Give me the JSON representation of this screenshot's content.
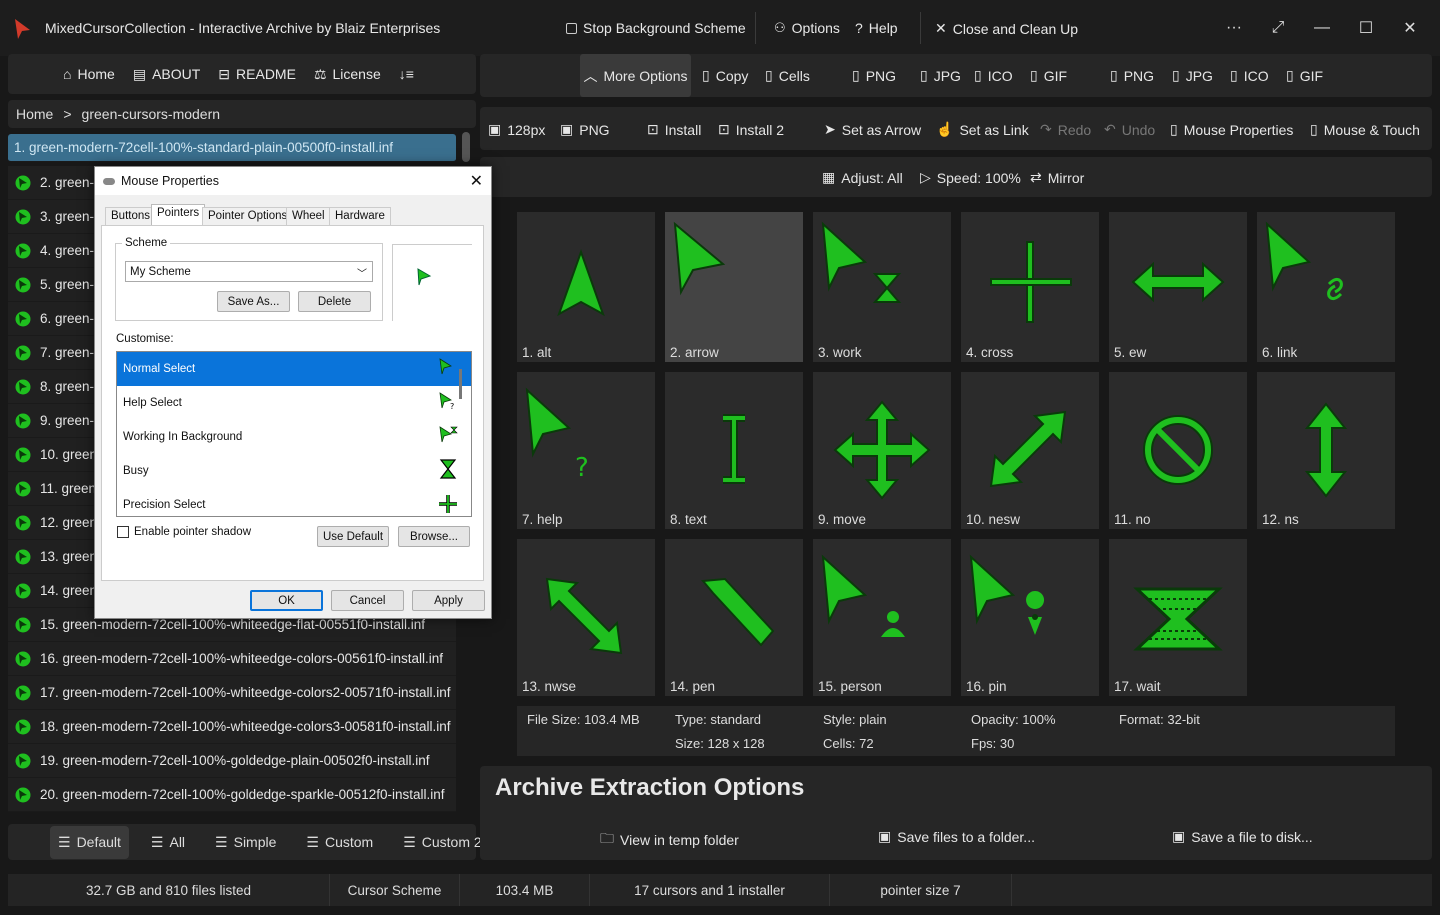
{
  "titlebar": {
    "app_title": "MixedCursorCollection  -  Interactive Archive by Blaiz Enterprises",
    "stop_bg": "Stop Background Scheme",
    "options": "Options",
    "help": "Help",
    "close_clean": "Close and Clean Up",
    "more": "···"
  },
  "leftnav": {
    "home": "Home",
    "about": "ABOUT",
    "readme": "README",
    "license": "License",
    "sort": "↓≡"
  },
  "breadcrumb": {
    "home": "Home",
    "sep": ">",
    "current": "green-cursors-modern"
  },
  "files": [
    "1. green-modern-72cell-100%-standard-plain-00500f0-install.inf",
    "2. green-m",
    "3. green-m",
    "4. green-m",
    "5. green-m",
    "6. green-m",
    "7. green-m",
    "8. green-m",
    "9. green-m",
    "10. green-",
    "11. green-",
    "12. green-",
    "13. green-",
    "14. green-",
    "15. green-modern-72cell-100%-whiteedge-flat-00551f0-install.inf",
    "16. green-modern-72cell-100%-whiteedge-colors-00561f0-install.inf",
    "17. green-modern-72cell-100%-whiteedge-colors2-00571f0-install.inf",
    "18. green-modern-72cell-100%-whiteedge-colors3-00581f0-install.inf",
    "19. green-modern-72cell-100%-goldedge-plain-00502f0-install.inf",
    "20. green-modern-72cell-100%-goldedge-sparkle-00512f0-install.inf"
  ],
  "bottom_tabs": [
    "Default",
    "All",
    "Simple",
    "Custom",
    "Custom 2"
  ],
  "toolbar1": {
    "more_options": "More Options",
    "copy": "Copy",
    "cells": "Cells",
    "png": "PNG",
    "jpg": "JPG",
    "ico": "ICO",
    "gif": "GIF"
  },
  "toolbar2": {
    "size": "128px",
    "png": "PNG",
    "install": "Install",
    "install2": "Install 2",
    "set_arrow": "Set as Arrow",
    "set_link": "Set as Link",
    "redo": "Redo",
    "undo": "Undo",
    "mouse_props": "Mouse Properties",
    "mouse_touch": "Mouse & Touch"
  },
  "toolbar3": {
    "adjust": "Adjust: All",
    "speed": "Speed: 100%",
    "mirror": "Mirror"
  },
  "cursors": [
    "1. alt",
    "2. arrow",
    "3. work",
    "4. cross",
    "5. ew",
    "6. link",
    "7. help",
    "8. text",
    "9. move",
    "10. nesw",
    "11. no",
    "12. ns",
    "13. nwse",
    "14. pen",
    "15. person",
    "16. pin",
    "17. wait"
  ],
  "info": {
    "file_size": "File Size: 103.4 MB",
    "type": "Type: standard",
    "style": "Style: plain",
    "opacity": "Opacity: 100%",
    "format": "Format: 32-bit",
    "size": "Size: 128 x 128",
    "cells": "Cells: 72",
    "fps": "Fps: 30"
  },
  "archive": {
    "title": "Archive Extraction Options",
    "view_temp": "View in temp folder",
    "save_folder": "Save files to a folder...",
    "save_disk": "Save a file to disk..."
  },
  "status": {
    "listed": "32.7 GB and 810 files listed",
    "scheme": "Cursor Scheme",
    "size": "103.4 MB",
    "count": "17 cursors and 1 installer",
    "pointer": "pointer size 7"
  },
  "dialog": {
    "title": "Mouse Properties",
    "tabs": [
      "Buttons",
      "Pointers",
      "Pointer Options",
      "Wheel",
      "Hardware"
    ],
    "scheme_label": "Scheme",
    "scheme_value": "My Scheme",
    "save_as": "Save As...",
    "delete": "Delete",
    "customise": "Customise:",
    "pointers": [
      "Normal Select",
      "Help Select",
      "Working In Background",
      "Busy",
      "Precision Select"
    ],
    "shadow": "Enable pointer shadow",
    "use_default": "Use Default",
    "browse": "Browse...",
    "ok": "OK",
    "cancel": "Cancel",
    "apply": "Apply"
  },
  "colors": {
    "accent_green": "#1fbf1f",
    "selected_row": "#3a6f8e",
    "dialog_select": "#0a74da"
  }
}
